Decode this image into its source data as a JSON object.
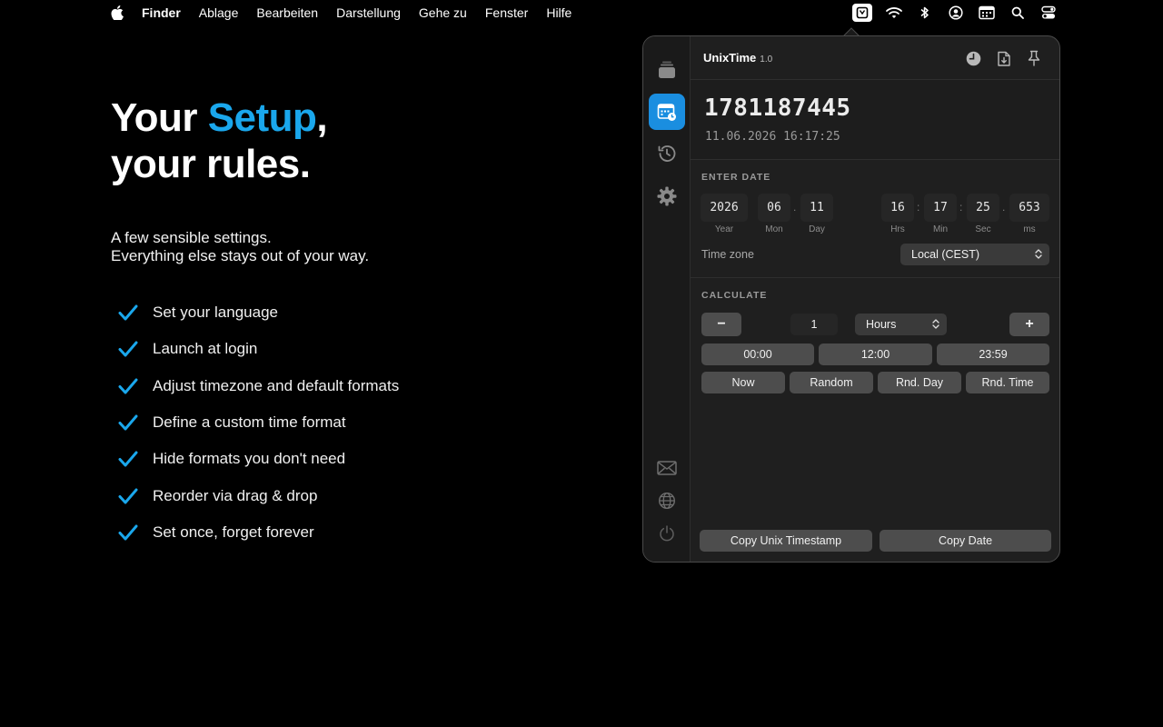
{
  "menubar": {
    "items": [
      "Finder",
      "Ablage",
      "Bearbeiten",
      "Darstellung",
      "Gehe zu",
      "Fenster",
      "Hilfe"
    ],
    "right_icons": [
      "unixtime-menubar-icon",
      "wifi-icon",
      "bluetooth-icon",
      "user-icon",
      "calendar-icon",
      "search-icon",
      "control-center-icon"
    ]
  },
  "hero": {
    "line1_start": "Your ",
    "line1_accent": "Setup",
    "line1_end": ",",
    "line2": "your rules.",
    "accent_color": "#1aa7ec"
  },
  "subtitle": {
    "line1": "A few sensible settings.",
    "line2": "Everything else stays out of your way."
  },
  "features": [
    "Set your language",
    "Launch at login",
    "Adjust timezone and default formats",
    "Define a custom time format",
    "Hide formats you don't need",
    "Reorder via drag & drop",
    "Set once, forget forever"
  ],
  "app": {
    "title": "UnixTime",
    "version": "1.0",
    "timestamp": "1781187445",
    "formatted_date": "11.06.2026 16:17:25",
    "enter_date_label": "ENTER DATE",
    "date_fields": {
      "year": "2026",
      "month": "06",
      "day": "11",
      "hours": "16",
      "minutes": "17",
      "seconds": "25",
      "ms": "653"
    },
    "date_field_labels": {
      "year": "Year",
      "month": "Mon",
      "day": "Day",
      "hours": "Hrs",
      "minutes": "Min",
      "seconds": "Sec",
      "ms": "ms"
    },
    "separators": {
      "dot": ".",
      "colon": ":"
    },
    "timezone_label": "Time zone",
    "timezone_value": "Local (CEST)",
    "calculate_label": "CALCULATE",
    "minus_label": "−",
    "plus_label": "+",
    "amount": "1",
    "unit": "Hours",
    "time_presets": [
      "00:00",
      "12:00",
      "23:59"
    ],
    "quick_buttons": [
      "Now",
      "Random",
      "Rnd. Day",
      "Rnd. Time"
    ],
    "copy_timestamp_label": "Copy Unix Timestamp",
    "copy_date_label": "Copy Date",
    "selected_color": "#1a8ee0"
  }
}
